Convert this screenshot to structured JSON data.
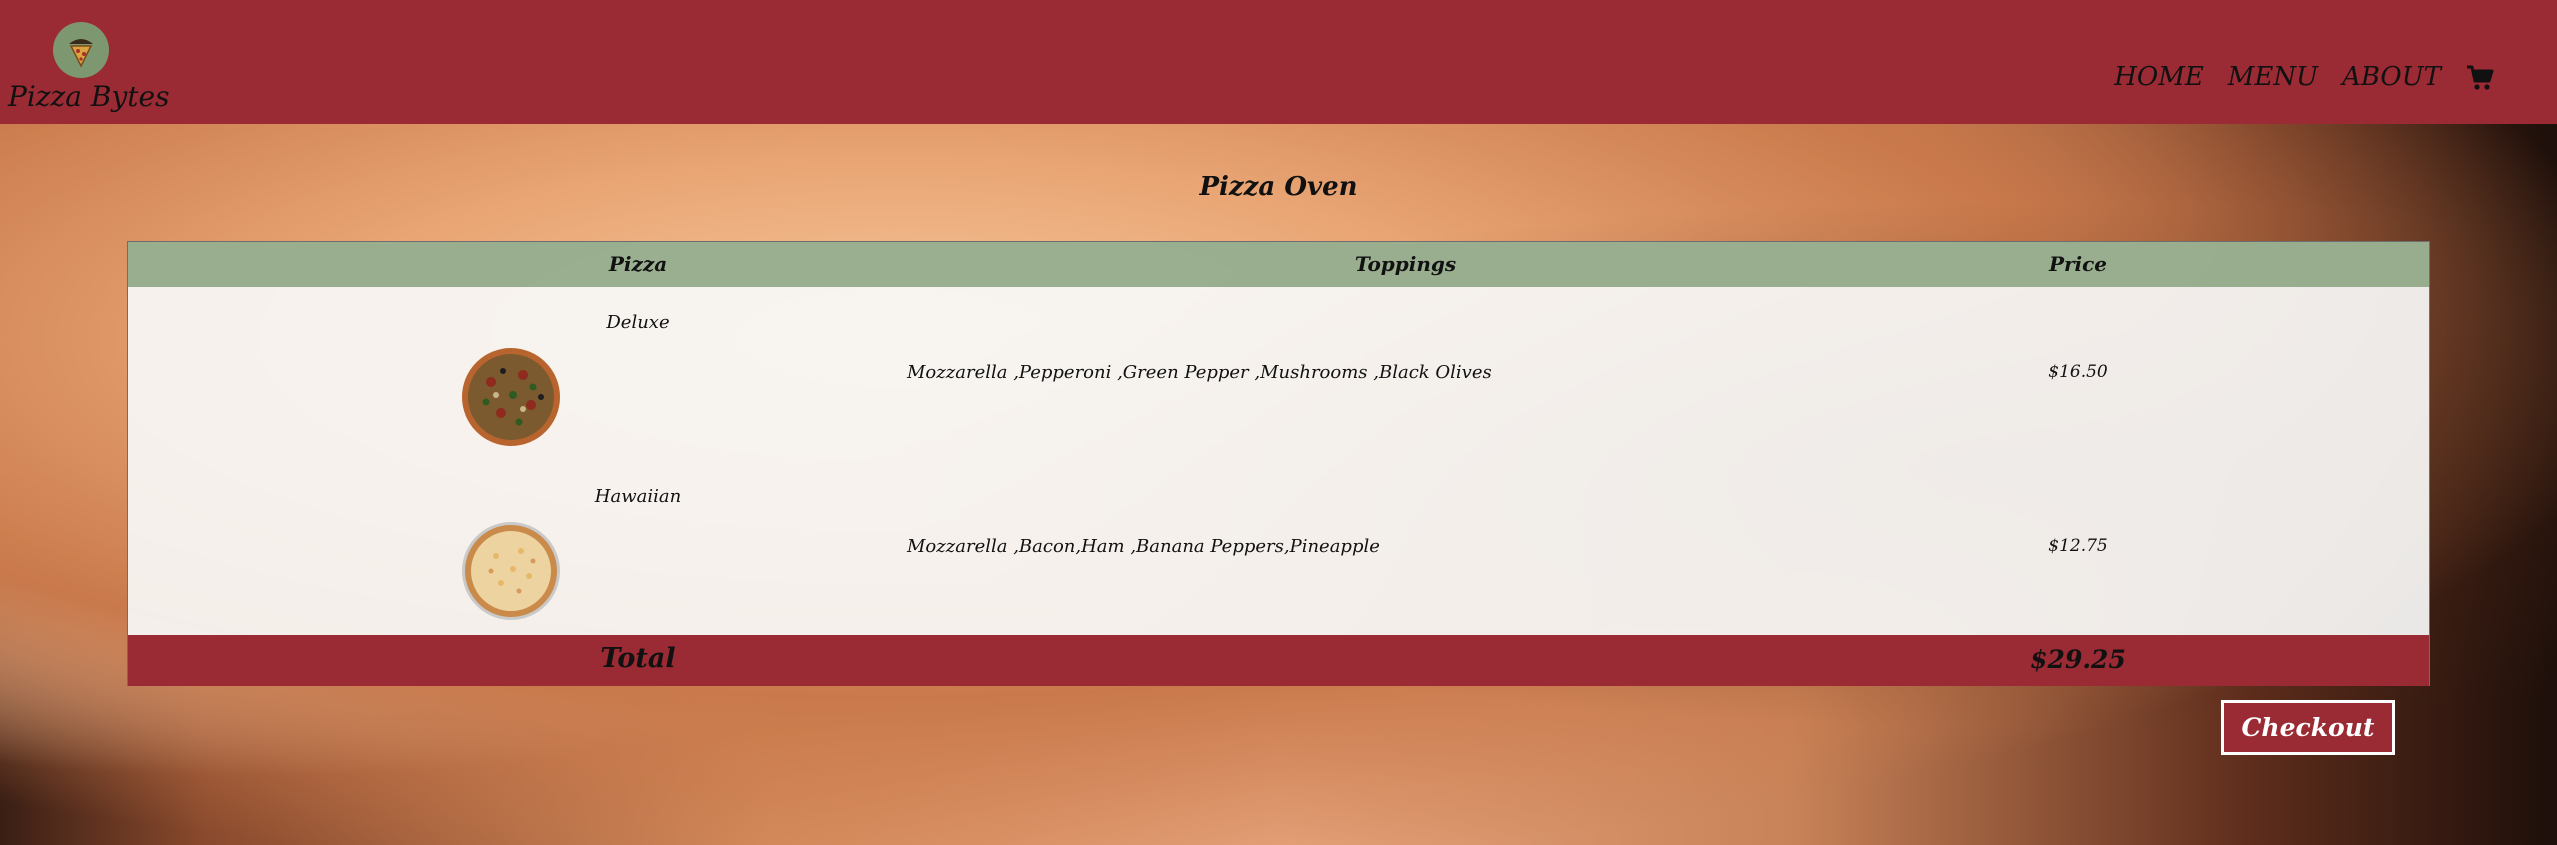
{
  "brand": {
    "name": "Pizza Bytes",
    "logo_icon": "pizza-chef-logo"
  },
  "nav": {
    "items": [
      {
        "label": "HOME"
      },
      {
        "label": "MENU"
      },
      {
        "label": "ABOUT"
      }
    ],
    "cart_icon": "shopping-cart-icon"
  },
  "page": {
    "title": "Pizza Oven"
  },
  "table": {
    "headers": {
      "pizza": "Pizza",
      "toppings": "Toppings",
      "price": "Price"
    },
    "rows": [
      {
        "name": "Deluxe",
        "image": "deluxe-pizza-image",
        "toppings": "Mozzarella ,Pepperoni ,Green Pepper ,Mushrooms ,Black Olives",
        "price": "$16.50"
      },
      {
        "name": "Hawaiian",
        "image": "hawaiian-pizza-image",
        "toppings": "Mozzarella ,Bacon,Ham ,Banana Peppers,Pineapple",
        "price": "$12.75"
      }
    ],
    "footer": {
      "label": "Total",
      "value": "$29.25"
    }
  },
  "checkout": {
    "label": "Checkout"
  },
  "colors": {
    "brand_red": "#9a2a33",
    "header_green": "#88a27e",
    "logo_green": "#7d9870"
  }
}
